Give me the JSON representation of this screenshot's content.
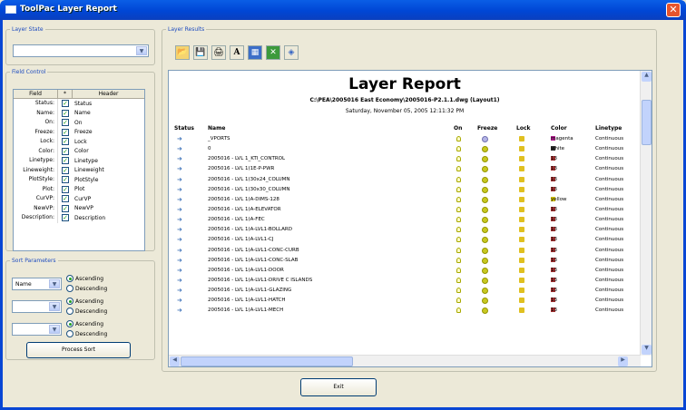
{
  "window": {
    "title": "ToolPac Layer Report",
    "close": "✕"
  },
  "layer_state": {
    "legend": "Layer State",
    "value": ""
  },
  "field_control": {
    "legend": "Field Control",
    "col_field": "Field",
    "col_star": "*",
    "col_header": "Header",
    "rows": [
      {
        "field": "Status:",
        "header": "Status"
      },
      {
        "field": "Name:",
        "header": "Name"
      },
      {
        "field": "On:",
        "header": "On"
      },
      {
        "field": "Freeze:",
        "header": "Freeze"
      },
      {
        "field": "Lock:",
        "header": "Lock"
      },
      {
        "field": "Color:",
        "header": "Color"
      },
      {
        "field": "Linetype:",
        "header": "Linetype"
      },
      {
        "field": "Lineweight:",
        "header": "Lineweight"
      },
      {
        "field": "PlotStyle:",
        "header": "PlotStyle"
      },
      {
        "field": "Plot:",
        "header": "Plot"
      },
      {
        "field": "CurVP:",
        "header": "CurVP"
      },
      {
        "field": "NewVP:",
        "header": "NewVP"
      },
      {
        "field": "Description:",
        "header": "Description"
      }
    ]
  },
  "sort": {
    "legend": "Sort Parameters",
    "groups": [
      {
        "value": "Name",
        "asc": "Ascending",
        "desc": "Descending"
      },
      {
        "value": "",
        "asc": "Ascending",
        "desc": "Descending"
      },
      {
        "value": "",
        "asc": "Ascending",
        "desc": "Descending"
      }
    ],
    "process": "Process Sort"
  },
  "results": {
    "legend": "Layer Results",
    "toolbar_icons": [
      "open-folder-icon",
      "save-disk-icon",
      "print-icon",
      "font-icon",
      "calculator-icon",
      "excel-icon",
      "layer-icon"
    ],
    "title": "Layer Report",
    "path": "C:\\PEA\\2005016 East Economy\\2005016-P2.1.1.dwg (Layout1)",
    "date": "Saturday, November 05, 2005  12:11:32 PM",
    "columns": {
      "status": "Status",
      "name": "Name",
      "on": "On",
      "freeze": "Freeze",
      "lock": "Lock",
      "color": "Color",
      "linetype": "Linetype"
    },
    "rows": [
      {
        "name": "_VPORTS",
        "color": "magenta",
        "sw": "#b0208f",
        "lt": "Continuous",
        "snow": true
      },
      {
        "name": "0",
        "color": "white",
        "sw": "#303030",
        "lt": "Continuous"
      },
      {
        "name": "2005016 - LVL 1_KTI_CONTROL",
        "color": "13",
        "sw": "#a03030",
        "lt": "Continuous"
      },
      {
        "name": "2005016 - LVL 1(1E-P-PWR",
        "color": "13",
        "sw": "#a03030",
        "lt": "Continuous"
      },
      {
        "name": "2005016 - LVL 1(30x24_COLUMN",
        "color": "13",
        "sw": "#a03030",
        "lt": "Continuous"
      },
      {
        "name": "2005016 - LVL 1(30x30_COLUMN",
        "color": "13",
        "sw": "#a03030",
        "lt": "Continuous"
      },
      {
        "name": "2005016 - LVL 1(A-DIMS-128",
        "color": "yellow",
        "sw": "#d0c000",
        "lt": "Continuous"
      },
      {
        "name": "2005016 - LVL 1(A-ELEVATOR",
        "color": "13",
        "sw": "#a03030",
        "lt": "Continuous"
      },
      {
        "name": "2005016 - LVL 1(A-FEC",
        "color": "13",
        "sw": "#a03030",
        "lt": "Continuous"
      },
      {
        "name": "2005016 - LVL 1(A-LVL1-BOLLARD",
        "color": "13",
        "sw": "#a03030",
        "lt": "Continuous"
      },
      {
        "name": "2005016 - LVL 1(A-LVL1-CJ",
        "color": "13",
        "sw": "#a03030",
        "lt": "Continuous"
      },
      {
        "name": "2005016 - LVL 1(A-LVL1-CONC-CURB",
        "color": "13",
        "sw": "#a03030",
        "lt": "Continuous"
      },
      {
        "name": "2005016 - LVL 1(A-LVL1-CONC-SLAB",
        "color": "13",
        "sw": "#a03030",
        "lt": "Continuous"
      },
      {
        "name": "2005016 - LVL 1(A-LVL1-DOOR",
        "color": "13",
        "sw": "#a03030",
        "lt": "Continuous"
      },
      {
        "name": "2005016 - LVL 1(A-LVL1-DRIVE C ISLANDS",
        "color": "13",
        "sw": "#a03030",
        "lt": "Continuous"
      },
      {
        "name": "2005016 - LVL 1(A-LVL1-GLAZING",
        "color": "13",
        "sw": "#a03030",
        "lt": "Continuous"
      },
      {
        "name": "2005016 - LVL 1(A-LVL1-HATCH",
        "color": "13",
        "sw": "#a03030",
        "lt": "Continuous"
      },
      {
        "name": "2005016 - LVL 1(A-LVL1-MECH",
        "color": "13",
        "sw": "#a03030",
        "lt": "Continuous"
      }
    ]
  },
  "exit": "Exit"
}
